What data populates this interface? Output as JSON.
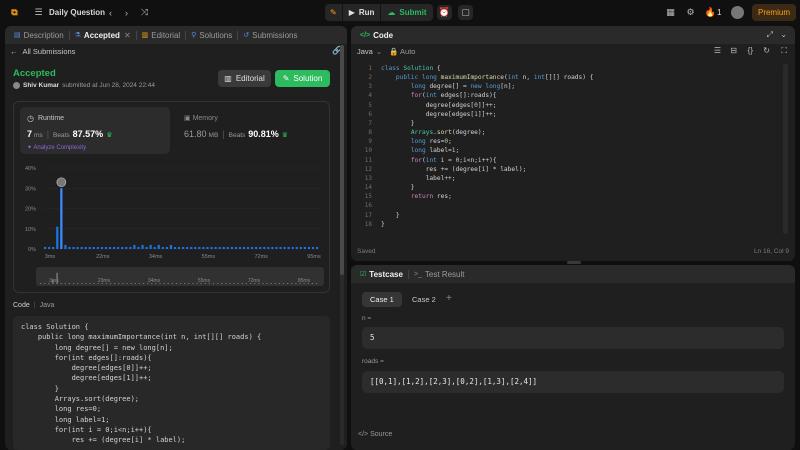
{
  "topbar": {
    "problem_list_label": "Daily Question",
    "run_label": "Run",
    "submit_label": "Submit",
    "streak_count": "1",
    "premium_label": "Premium"
  },
  "left_panel": {
    "tabs": [
      {
        "label": "Description"
      },
      {
        "label": "Accepted"
      },
      {
        "label": "Editorial"
      },
      {
        "label": "Solutions"
      },
      {
        "label": "Submissions"
      }
    ],
    "back_label": "All Submissions",
    "status": "Accepted",
    "author_name": "Shiv Kumar",
    "submitted_text": "submitted at Jun 28, 2024 22:44",
    "editorial_button": "Editorial",
    "solution_button": "Solution",
    "runtime": {
      "label": "Runtime",
      "value": "7",
      "unit": "ms",
      "beats_label": "Beats",
      "beats_value": "87.57%",
      "analyze_label": "Analyze Complexity"
    },
    "memory": {
      "label": "Memory",
      "value": "61.80",
      "unit": "MB",
      "beats_label": "Beats",
      "beats_value": "90.81%"
    },
    "code_label": "Code",
    "code_lang": "Java",
    "code_lines": [
      "class Solution {",
      "    public long maximumImportance(int n, int[][] roads) {",
      "        long degree[] = new long[n];",
      "        for(int edges[]:roads){",
      "            degree[edges[0]]++;",
      "            degree[edges[1]]++;",
      "        }",
      "        Arrays.sort(degree);",
      "        long res=0;",
      "        long label=1;",
      "        for(int i = 0;i<n;i++){",
      "            res += (degree[i] * label);"
    ]
  },
  "chart_data": {
    "type": "bar",
    "title": "",
    "ylabel": "",
    "xlabel": "",
    "yticks": [
      "40%",
      "30%",
      "20%",
      "10%",
      "0%"
    ],
    "ylim": [
      0,
      40
    ],
    "xticks": [
      "3ms",
      "22ms",
      "34ms",
      "55ms",
      "72ms",
      "95ms"
    ],
    "highlight_category": "7ms",
    "categories": [
      "3ms",
      "4ms",
      "5ms",
      "6ms",
      "7ms",
      "8ms",
      "9ms",
      "10ms",
      "11ms",
      "12ms",
      "13ms",
      "14ms",
      "15ms",
      "16ms",
      "17ms",
      "18ms",
      "19ms",
      "20ms",
      "21ms",
      "22ms",
      "23ms",
      "24ms",
      "25ms",
      "26ms",
      "27ms",
      "28ms",
      "29ms",
      "30ms",
      "31ms",
      "32ms",
      "33ms",
      "34ms",
      "35ms",
      "36ms",
      "37ms",
      "38ms",
      "39ms",
      "40ms",
      "41ms",
      "42ms",
      "43ms",
      "44ms",
      "45ms",
      "46ms",
      "47ms",
      "48ms",
      "49ms",
      "50ms",
      "51ms",
      "52ms",
      "53ms",
      "54ms",
      "55ms",
      "56ms",
      "57ms",
      "58ms",
      "59ms",
      "60ms",
      "61ms",
      "62ms",
      "63ms",
      "64ms",
      "65ms",
      "66ms",
      "67ms",
      "68ms",
      "69ms",
      "70ms"
    ],
    "values": [
      1,
      1,
      1,
      11,
      30,
      2,
      1,
      1,
      1,
      1,
      1,
      1,
      1,
      1,
      1,
      1,
      1,
      1,
      1,
      1,
      1,
      1,
      2,
      1,
      2,
      1,
      2,
      1,
      2,
      1,
      1,
      2,
      1,
      1,
      1,
      1,
      1,
      1,
      1,
      1,
      1,
      1,
      1,
      1,
      1,
      1,
      1,
      1,
      1,
      1,
      1,
      1,
      1,
      1,
      1,
      1,
      1,
      1,
      1,
      1,
      1,
      1,
      1,
      1,
      1,
      1,
      1,
      1
    ],
    "overview_ticks": [
      "3ms",
      "23ms",
      "34ms",
      "55ms",
      "72ms",
      "85ms"
    ],
    "grid": true,
    "legend": "none"
  },
  "code_panel": {
    "title": "Code",
    "language": "Java",
    "autosave": "Auto",
    "status_left": "Saved",
    "status_right": "Ln 16, Col 9"
  },
  "testcase_panel": {
    "tab_testcase": "Testcase",
    "tab_result": "Test Result",
    "case1": "Case 1",
    "case2": "Case 2",
    "field1_label": "n =",
    "field1_value": "5",
    "field2_label": "roads =",
    "field2_value": "[[0,1],[1,2],[2,3],[0,2],[1,3],[2,4]]",
    "source_label": "Source"
  },
  "colors": {
    "accent_green": "#2cbb5d",
    "accent_orange": "#ffa116",
    "bar_blue": "#1a73e8"
  }
}
